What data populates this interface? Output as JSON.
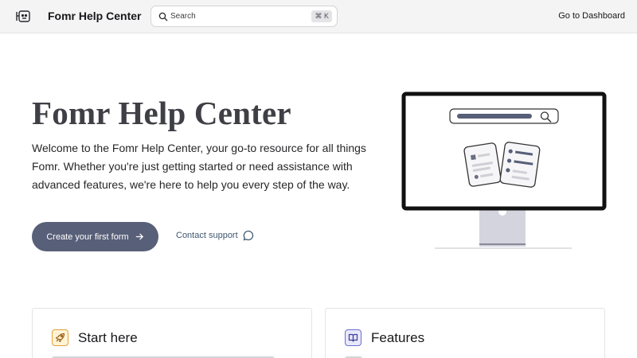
{
  "header": {
    "logo_icon": "robot-logo-icon",
    "brand": "Fomr Help Center",
    "search": {
      "icon": "search-icon",
      "placeholder": "Search",
      "shortcut": "⌘ K"
    },
    "dashboard_link": "Go to Dashboard"
  },
  "hero": {
    "title": "Fomr Help Center",
    "description": "Welcome to the Fomr Help Center, your go-to resource for all things Fomr. Whether you're just getting started or need assistance with advanced features, we're here to help you every step of the way.",
    "primary_button": {
      "label": "Create your first form",
      "icon": "arrow-right-icon"
    },
    "secondary_link": {
      "label": "Contact support",
      "icon": "chat-bubble-icon"
    },
    "illustration": "monitor-with-search-and-documents-illustration"
  },
  "cards": [
    {
      "title": "Start here",
      "icon": "rocket-icon",
      "accent": "#e6a03a"
    },
    {
      "title": "Features",
      "icon": "book-icon",
      "accent": "#6b6fcf"
    }
  ],
  "colors": {
    "header_bg": "#f4f4f5",
    "primary_button": "#585f78",
    "title": "#3f3f46",
    "link": "#3f5870"
  }
}
